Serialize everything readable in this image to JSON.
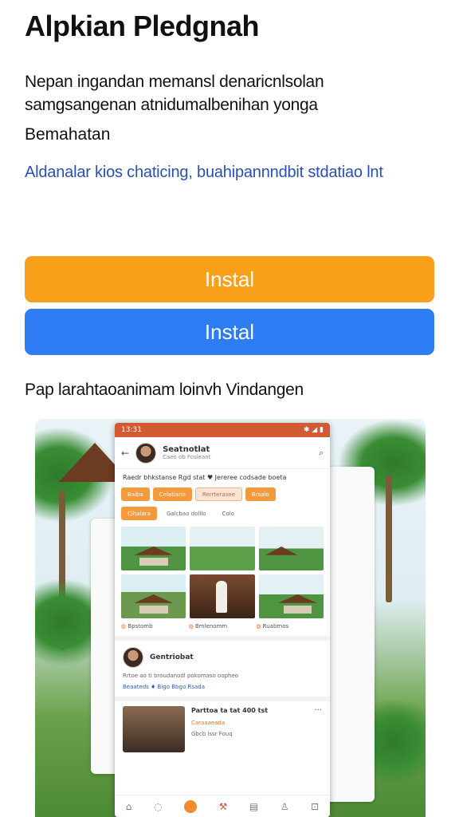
{
  "app": {
    "title": "Alpkian Pledgnah",
    "description": "Nepan ingandan memansl denaricnlsolan samgsangenan atnidumalbenihan yonga",
    "subtitle": "Bemahatan",
    "link_text": "Aldanalar kios chaticing, buahipannndbit stdatiao lnt"
  },
  "buttons": {
    "install_primary": "Instal",
    "install_secondary": "Instal"
  },
  "screenshots": {
    "label": "Pap larahtaoanimam loinvh Vindangen",
    "phone": {
      "status_time": "13:31",
      "status_icons": "✱ ◢ ▮",
      "profile_name": "Seatnotlat",
      "profile_sub": "Caeo ob Fosleant",
      "intro_text": "Raedr bhkstanse Rgd stat ♥ Jereree codsade boeta",
      "chips_row1": [
        "Baiba",
        "Celatiano",
        "Rerrterasee",
        "Brsalo"
      ],
      "chips_row2": [
        "Cihalara",
        "Galcbao dolllo",
        "Colo"
      ],
      "tile_captions": [
        "Bpstomb",
        "Bmlenomm",
        "Ruabmos"
      ],
      "post_author": "Gentriobat",
      "post_text": "Rrtoe ao ti broudanodl pokomaso oopheo",
      "post_links": "Beaateds ♦ Bigo  Bbgo  Rsada",
      "card_title": "Parttoa ta tat 400 tst",
      "card_meta": "Caraaaeada",
      "card_meta2": "Gbcb lssr Fouq",
      "more_icon": "more-horizontal-icon"
    }
  },
  "colors": {
    "orange": "#f9a01b",
    "blue": "#2e7cf3",
    "link": "#2a4fb0",
    "status_bar": "#d25a32"
  }
}
